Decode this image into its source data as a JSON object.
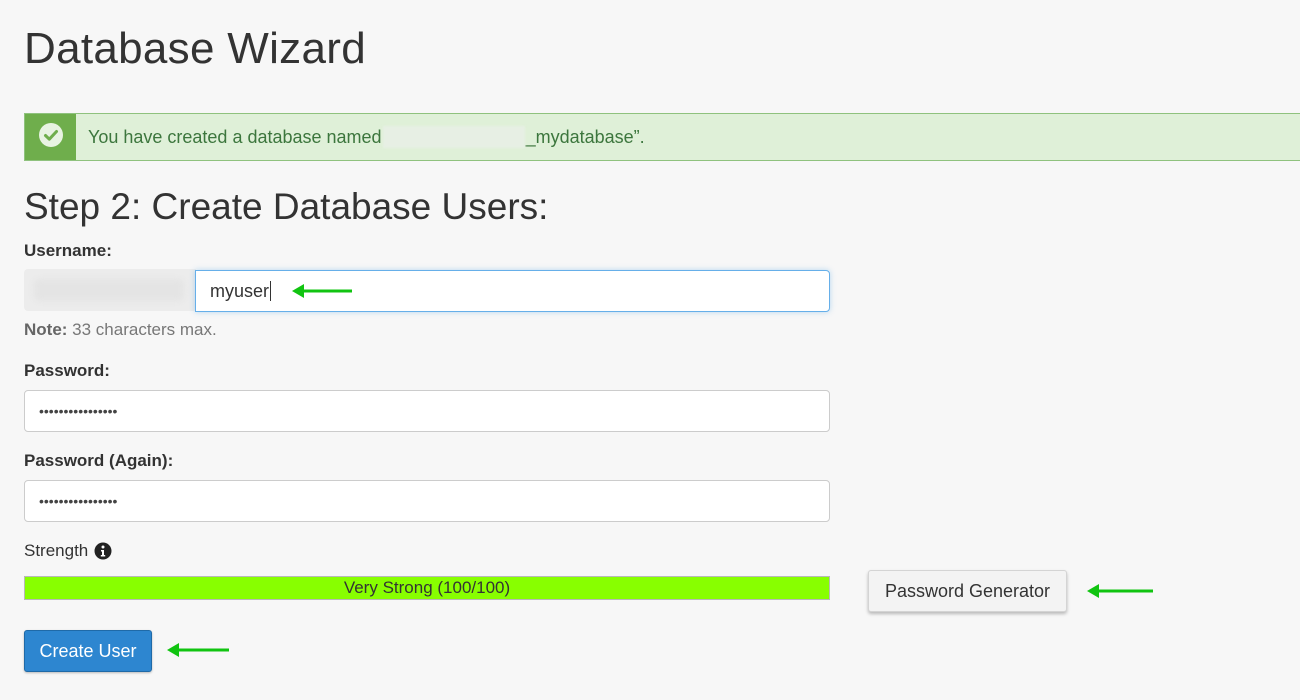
{
  "page": {
    "title": "Database Wizard"
  },
  "alert": {
    "text_before": "You have created a database named",
    "text_after": "_mydatabase”.",
    "status_color": "#6fae4c"
  },
  "step": {
    "title": "Step 2: Create Database Users:"
  },
  "username": {
    "label": "Username:",
    "value": "myuser",
    "note_bold": "Note:",
    "note_text": " 33 characters max."
  },
  "password": {
    "label": "Password:",
    "value": "••••••••••••••••"
  },
  "password_again": {
    "label": "Password (Again):",
    "value": "••••••••••••••••"
  },
  "strength": {
    "label": "Strength",
    "bar_text": "Very Strong (100/100)",
    "score": 100,
    "max": 100,
    "color": "#88ff00",
    "icon": "info-icon"
  },
  "buttons": {
    "password_generator": "Password Generator",
    "create_user": "Create User",
    "create_user_color": "#2d86d0"
  },
  "annotations": {
    "arrow_color": "#11c411"
  }
}
